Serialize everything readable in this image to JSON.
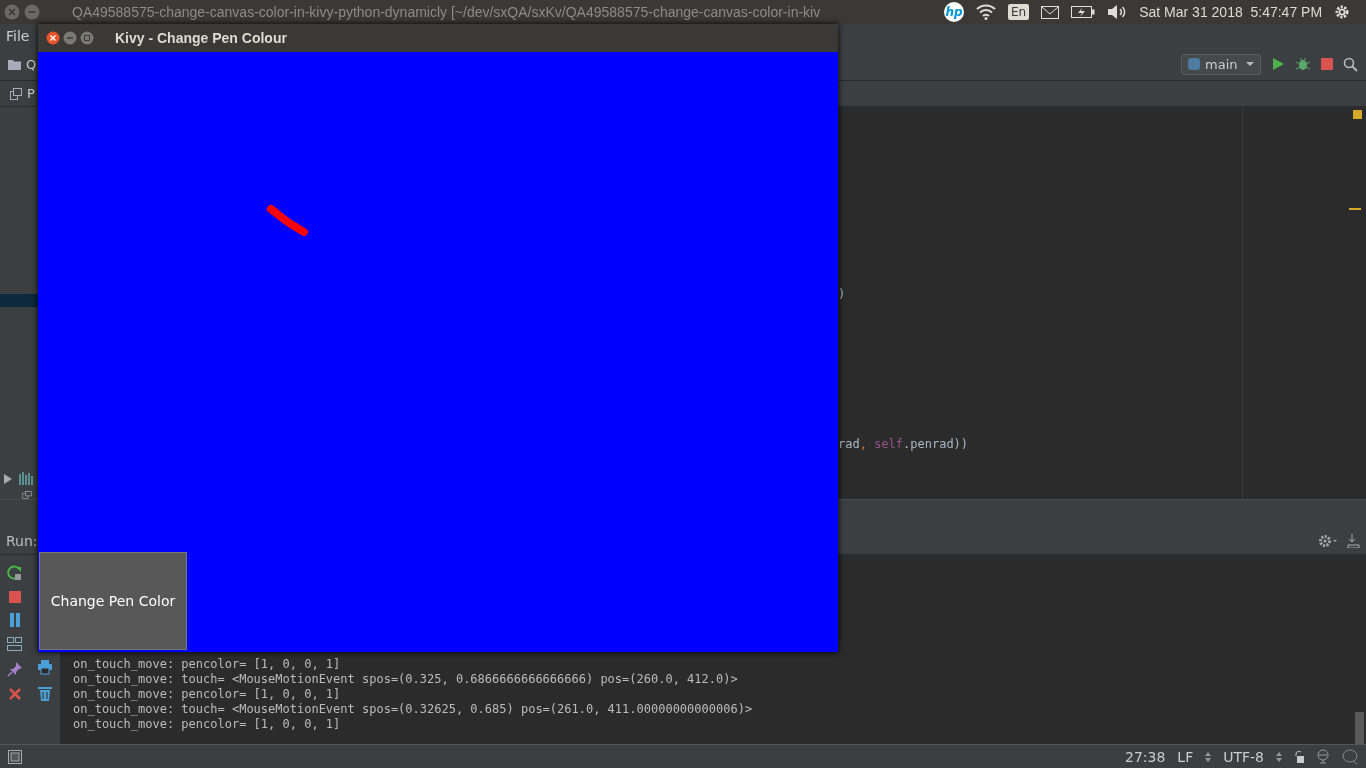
{
  "top_bar": {
    "title": "QA49588575-change-canvas-color-in-kivy-python-dynamicly [~/dev/sxQA/sxKv/QA49588575-change-canvas-color-in-kiv",
    "logo": "hp",
    "keyboard": "En",
    "clock": "Sat Mar 31 2018  5:47:47 PM"
  },
  "menu": [
    "File"
  ],
  "nav_bar": {
    "crumb": "Q",
    "run_config": "main"
  },
  "editor_tab": {
    "label": "P"
  },
  "code_lines": [
    {
      "tokens": [
        {
          "text": ")",
          "kind": "plain"
        }
      ]
    },
    {
      "tokens": [
        {
          "text": "rad",
          "kind": "plain"
        },
        {
          "text": ",",
          "kind": "punct"
        },
        {
          "text": " self",
          "kind": "keyword"
        },
        {
          "text": ".penrad))",
          "kind": "plain"
        }
      ]
    }
  ],
  "run_panel": {
    "label": "Run:",
    "lines": [
      "on_touch_move: pencolor= [1, 0, 0, 1]",
      "on_touch_move: touch= <MouseMotionEvent spos=(0.325, 0.6866666666666666) pos=(260.0, 412.0)>",
      "on_touch_move: pencolor= [1, 0, 0, 1]",
      "on_touch_move: touch= <MouseMotionEvent spos=(0.32625, 0.685) pos=(261.0, 411.00000000000006)>",
      "on_touch_move: pencolor= [1, 0, 0, 1]"
    ]
  },
  "status_bar": {
    "position": "27:38",
    "line_sep": "LF",
    "encoding": "UTF-8"
  },
  "kivy_window": {
    "title": "Kivy - Change Pen Colour",
    "button": "Change Pen Color"
  }
}
